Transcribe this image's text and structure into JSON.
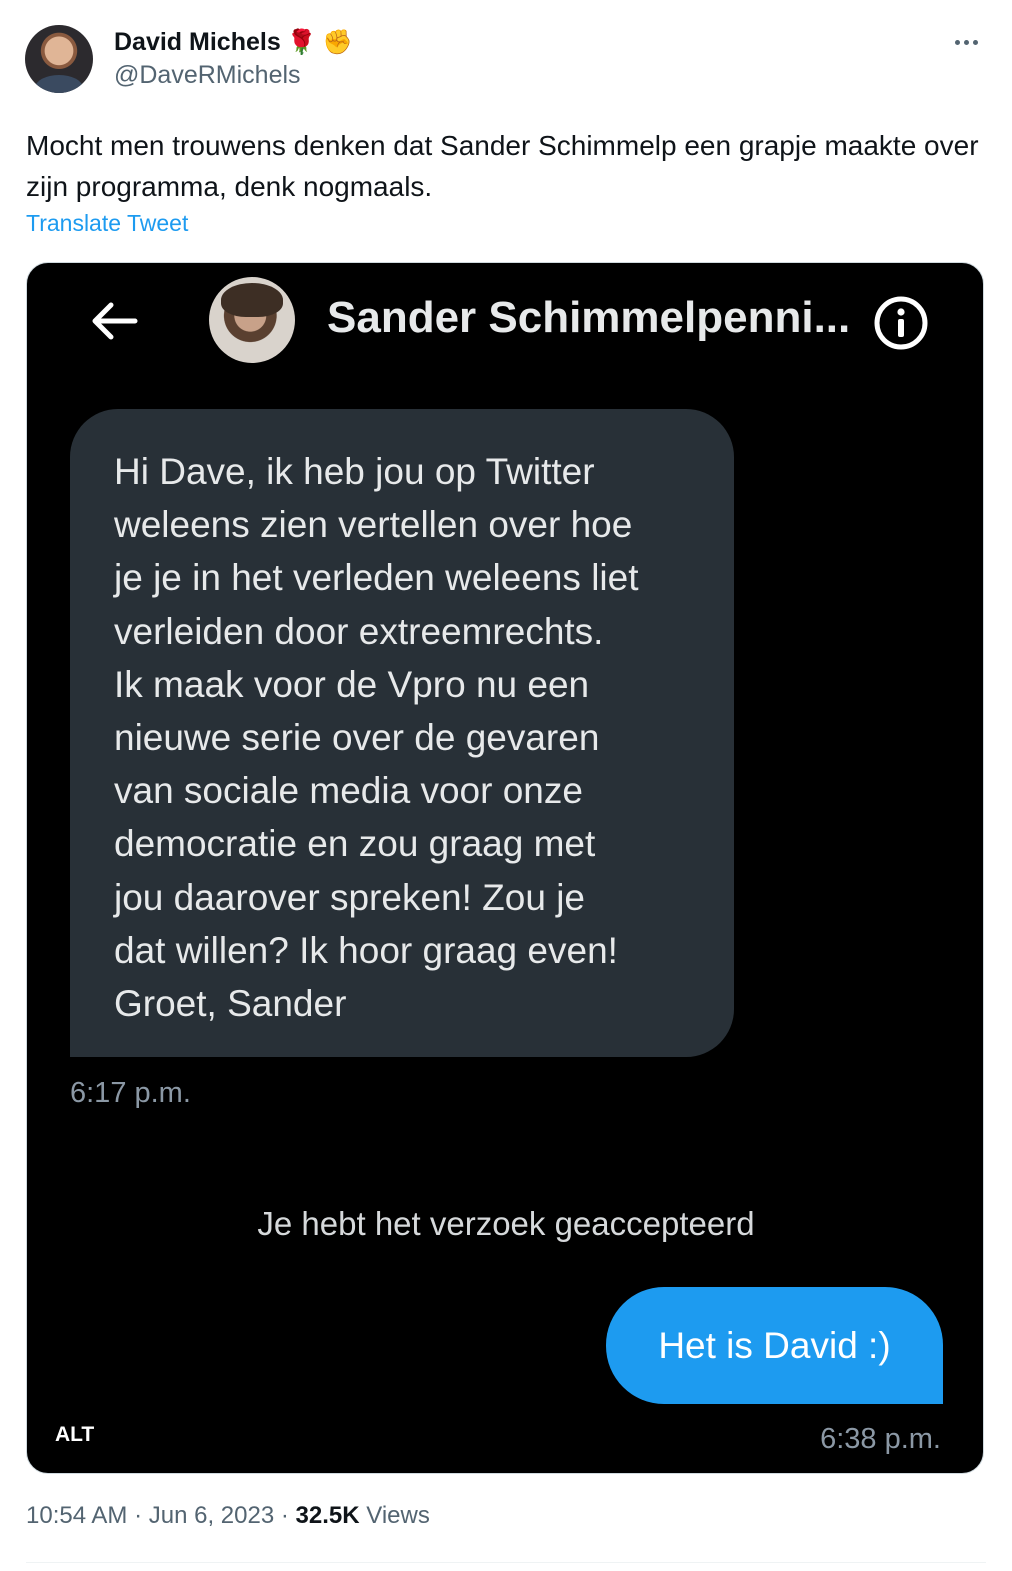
{
  "author": {
    "display_name": "David Michels",
    "handle": "@DaveRMichels",
    "emojis": [
      "🌹",
      "✊"
    ]
  },
  "tweet": {
    "text": "Mocht men trouwens denken dat Sander Schimmelp een grapje maakte over zijn programma, denk nogmaals.",
    "translate_label": "Translate Tweet"
  },
  "media": {
    "alt_label": "ALT",
    "dm_header": {
      "contact_name": "Sander Schimmelpenni..."
    },
    "incoming_message": {
      "text": "Hi Dave, ik heb jou op Twitter\nweleens zien vertellen over hoe\nje je in het verleden weleens liet\nverleiden door extreemrechts.\nIk maak voor de Vpro nu een\nnieuwe serie over de gevaren\nvan sociale media voor onze\ndemocratie en zou graag met\njou daarover spreken! Zou je\ndat willen? Ik hoor graag even!\nGroet, Sander",
      "time": "6:17 p.m."
    },
    "system_message": "Je hebt het verzoek geaccepteerd",
    "outgoing_message": {
      "text": "Het is David :)",
      "time": "6:38 p.m."
    }
  },
  "footer": {
    "time": "10:54 AM",
    "separator": "·",
    "date": "Jun 6, 2023",
    "views_count": "32.5K",
    "views_label": "Views"
  },
  "colors": {
    "accent": "#1d9bf0",
    "dm_bubble_incoming": "#283037",
    "media_background": "#000000"
  }
}
